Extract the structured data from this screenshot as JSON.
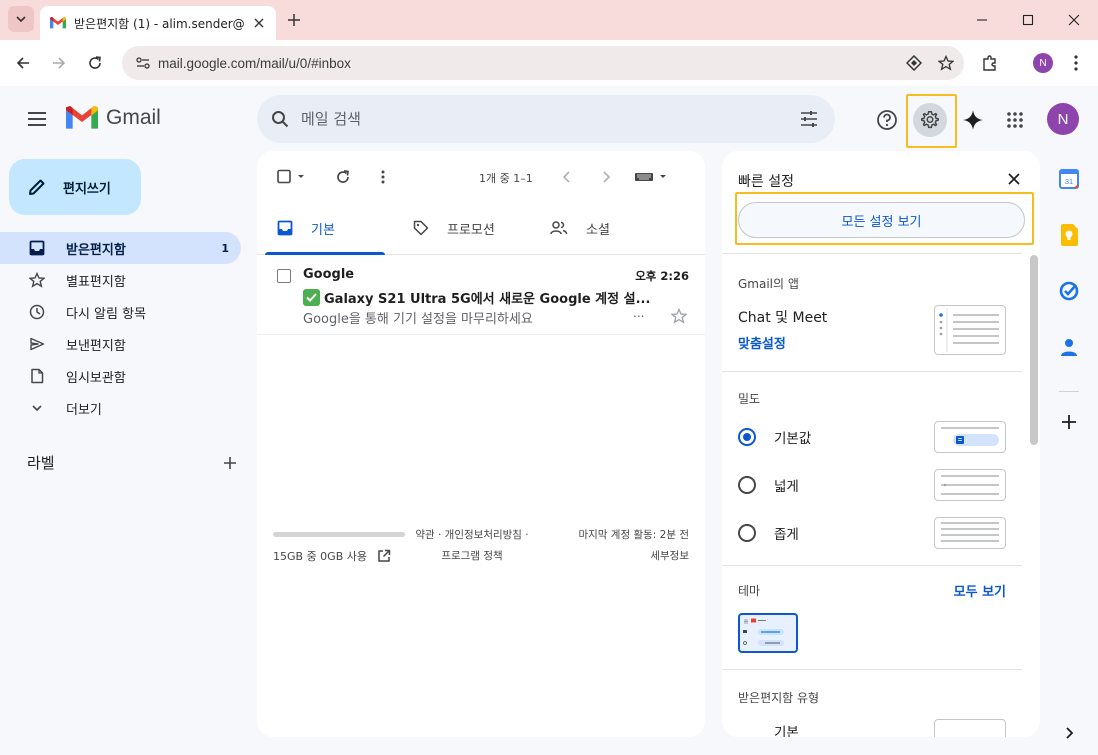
{
  "browser": {
    "tab_title": "받은편지함 (1) - alim.sender@",
    "url": "mail.google.com/mail/u/0/#inbox",
    "profile_initial": "N"
  },
  "gmail": {
    "app_name": "Gmail",
    "search_placeholder": "메일 검색",
    "avatar_initial": "N",
    "compose_label": "편지쓰기",
    "nav": [
      {
        "label": "받은편지함",
        "count": "1",
        "icon": "inbox-icon"
      },
      {
        "label": "별표편지함",
        "count": "",
        "icon": "star-icon"
      },
      {
        "label": "다시 알림 항목",
        "count": "",
        "icon": "clock-icon"
      },
      {
        "label": "보낸편지함",
        "count": "",
        "icon": "send-icon"
      },
      {
        "label": "임시보관함",
        "count": "",
        "icon": "draft-icon"
      },
      {
        "label": "더보기",
        "count": "",
        "icon": "chevron-down-icon"
      }
    ],
    "labels_title": "라벨",
    "pager": "1개 중 1–1",
    "tabs": [
      {
        "label": "기본"
      },
      {
        "label": "프로모션"
      },
      {
        "label": "소셜"
      }
    ],
    "emails": [
      {
        "sender": "Google",
        "time": "오후 2:26",
        "subject": "Galaxy S21 Ultra 5G에서 새로운 Google 계정 설...",
        "snippet": "Google을 통해 기기 설정을 마무리하세요",
        "more": "..."
      }
    ],
    "footer": {
      "storage": "15GB 중 0GB 사용",
      "storage_used_fraction": 0,
      "links_line1": "약관 · 개인정보처리방침 ·",
      "links_line2": "프로그램 정책",
      "activity_line1": "마지막 계정 활동: 2분 전",
      "activity_line2": "세부정보"
    }
  },
  "quick_settings": {
    "title": "빠른 설정",
    "see_all": "모든 설정 보기",
    "apps_section": "Gmail의 앱",
    "chat_meet": "Chat 및 Meet",
    "customize": "맞춤설정",
    "density_section": "밀도",
    "density_options": [
      {
        "label": "기본값",
        "selected": true
      },
      {
        "label": "넓게",
        "selected": false
      },
      {
        "label": "좁게",
        "selected": false
      }
    ],
    "theme_section": "테마",
    "theme_see_all": "모두 보기",
    "inbox_type_section": "받은편지함 유형",
    "inbox_type_first": "기본"
  },
  "colors": {
    "accent": "#0b57d0",
    "highlight": "#f5bd1f",
    "compose_bg": "#c2e7ff",
    "nav_active_bg": "#d3e3fd"
  }
}
